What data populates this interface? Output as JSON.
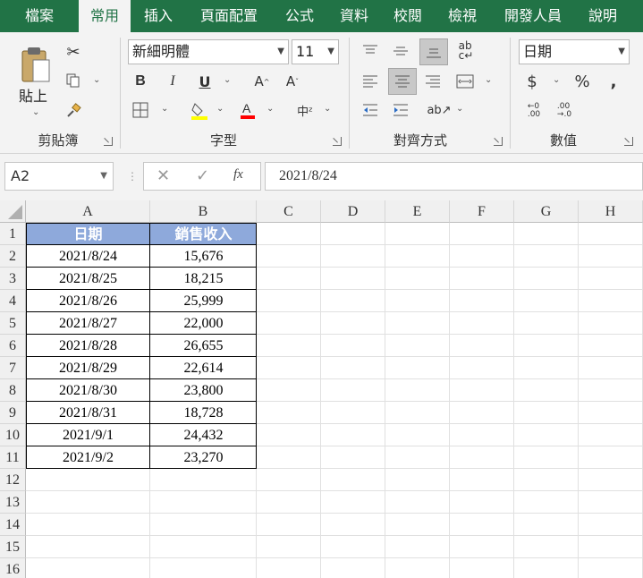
{
  "tabs": [
    "檔案",
    "常用",
    "插入",
    "頁面配置",
    "公式",
    "資料",
    "校閱",
    "檢視",
    "開發人員",
    "說明"
  ],
  "active_tab": "常用",
  "clipboard": {
    "paste_label": "貼上",
    "group_label": "剪貼簿"
  },
  "font": {
    "name": "新細明體",
    "size": "11",
    "group_label": "字型"
  },
  "alignment": {
    "group_label": "對齊方式"
  },
  "number": {
    "format": "日期",
    "group_label": "數值"
  },
  "name_box": "A2",
  "formula": "2021/8/24",
  "columns": [
    "A",
    "B",
    "C",
    "D",
    "E",
    "F",
    "G",
    "H"
  ],
  "rows": [
    "1",
    "2",
    "3",
    "4",
    "5",
    "6",
    "7",
    "8",
    "9",
    "10",
    "11",
    "12",
    "13",
    "14",
    "15",
    "16"
  ],
  "table": {
    "headers": [
      "日期",
      "銷售收入"
    ],
    "data": [
      [
        "2021/8/24",
        "15,676"
      ],
      [
        "2021/8/25",
        "18,215"
      ],
      [
        "2021/8/26",
        "25,999"
      ],
      [
        "2021/8/27",
        "22,000"
      ],
      [
        "2021/8/28",
        "26,655"
      ],
      [
        "2021/8/29",
        "22,614"
      ],
      [
        "2021/8/30",
        "23,800"
      ],
      [
        "2021/8/31",
        "18,728"
      ],
      [
        "2021/9/1",
        "24,432"
      ],
      [
        "2021/9/2",
        "23,270"
      ]
    ]
  },
  "colors": {
    "accent": "#217346",
    "table_header": "#8ea9db"
  }
}
